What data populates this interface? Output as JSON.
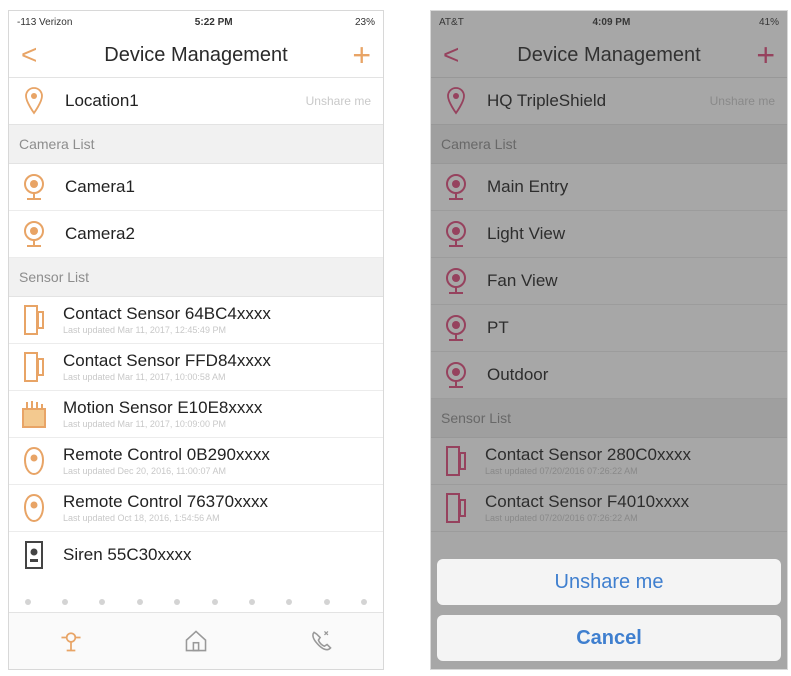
{
  "left": {
    "status": {
      "carrier": "-113 Verizon",
      "time": "5:22 PM",
      "battery": "23%"
    },
    "nav": {
      "title": "Device Management",
      "back": "<",
      "add": "+"
    },
    "location": {
      "name": "Location1",
      "status": "Unshare me"
    },
    "camera_section": "Camera List",
    "cameras": [
      "Camera1",
      "Camera2"
    ],
    "sensor_section": "Sensor List",
    "sensors": [
      {
        "name": "Contact Sensor 64BC4xxxx",
        "sub": "Last updated Mar 11, 2017, 12:45:49 PM",
        "icon": "contact-sensor-icon"
      },
      {
        "name": "Contact Sensor FFD84xxxx",
        "sub": "Last updated Mar 11, 2017, 10:00:58 AM",
        "icon": "contact-sensor-icon"
      },
      {
        "name": "Motion Sensor E10E8xxxx",
        "sub": "Last updated Mar 11, 2017, 10:09:00 PM",
        "icon": "motion-sensor-icon"
      },
      {
        "name": "Remote Control 0B290xxxx",
        "sub": "Last updated Dec 20, 2016, 11:00:07 AM",
        "icon": "remote-control-icon"
      },
      {
        "name": "Remote Control 76370xxxx",
        "sub": "Last updated Oct 18, 2016, 1:54:56 AM",
        "icon": "remote-control-icon"
      },
      {
        "name": "Siren 55C30xxxx",
        "sub": "",
        "icon": "siren-icon"
      }
    ],
    "colors": {
      "accent": "#e8a466"
    }
  },
  "right": {
    "status": {
      "carrier": "AT&T",
      "time": "4:09 PM",
      "battery": "41%"
    },
    "nav": {
      "title": "Device Management",
      "back": "<",
      "add": "+"
    },
    "location": {
      "name": "HQ TripleShield",
      "status": "Unshare me"
    },
    "camera_section": "Camera List",
    "cameras": [
      "Main Entry",
      "Light View",
      "Fan View",
      "PT",
      "Outdoor"
    ],
    "sensor_section": "Sensor List",
    "sensors": [
      {
        "name": "Contact Sensor 280C0xxxx",
        "sub": "Last updated 07/20/2016 07:26:22 AM"
      },
      {
        "name": "Contact Sensor F4010xxxx",
        "sub": "Last updated 07/20/2016 07:26:22 AM"
      }
    ],
    "sheet": {
      "unshare": "Unshare me",
      "cancel": "Cancel"
    },
    "colors": {
      "accent": "#e0487a",
      "link": "#3f7fcf"
    }
  }
}
